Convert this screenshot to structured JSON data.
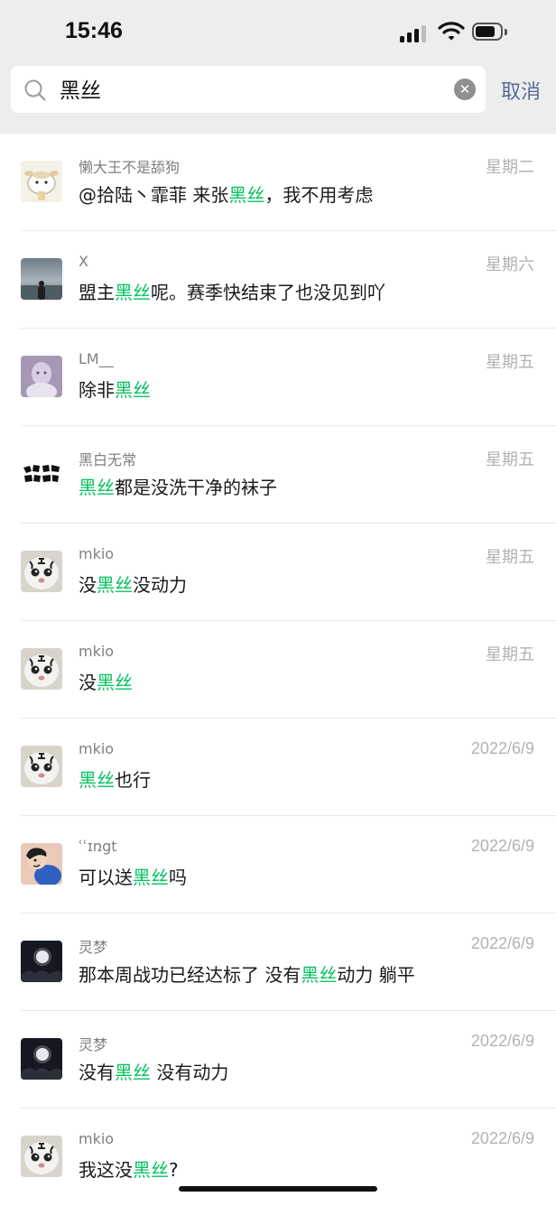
{
  "status_bar": {
    "time": "15:46"
  },
  "search": {
    "query": "黑丝",
    "cancel_label": "取消"
  },
  "results": [
    {
      "name": "懒大王不是舔狗",
      "date": "星期二",
      "pre": "@拾陆丶霏菲 来张",
      "hl": "黑丝",
      "post": "，我不用考虑"
    },
    {
      "name": "X",
      "date": "星期六",
      "pre": "盟主",
      "hl": "黑丝",
      "post": "呢。赛季快结束了也没见到吖"
    },
    {
      "name": "LM__",
      "date": "星期五",
      "pre": "除非",
      "hl": "黑丝",
      "post": ""
    },
    {
      "name": "黑白无常",
      "date": "星期五",
      "pre": "",
      "hl": "黑丝",
      "post": "都是没洗干净的袜子"
    },
    {
      "name": "mkio",
      "date": "星期五",
      "pre": "没",
      "hl": "黑丝",
      "post": "没动力"
    },
    {
      "name": "mkio",
      "date": "星期五",
      "pre": "没",
      "hl": "黑丝",
      "post": ""
    },
    {
      "name": "mkio",
      "date": "2022/6/9",
      "pre": "",
      "hl": "黑丝",
      "post": "也行"
    },
    {
      "name": "ʿʿɪռgt",
      "date": "2022/6/9",
      "pre": "可以送",
      "hl": "黑丝",
      "post": "吗"
    },
    {
      "name": "灵梦",
      "date": "2022/6/9",
      "pre": "那本周战功已经达标了 没有",
      "hl": "黑丝",
      "post": "动力 躺平"
    },
    {
      "name": "灵梦",
      "date": "2022/6/9",
      "pre": "没有",
      "hl": "黑丝",
      "post": " 没有动力"
    },
    {
      "name": "mkio",
      "date": "2022/6/9",
      "pre": "我这没",
      "hl": "黑丝",
      "post": "?"
    }
  ]
}
